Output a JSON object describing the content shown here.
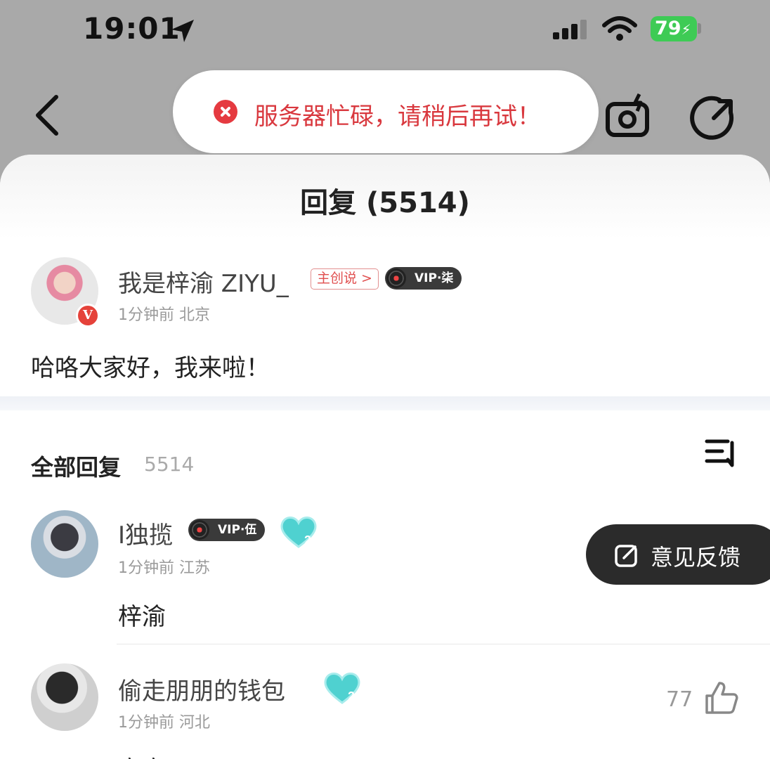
{
  "status_bar": {
    "time": "19:01",
    "battery": "79",
    "icons": [
      "location-arrow-icon",
      "signal-icon",
      "wifi-icon",
      "battery-charging-icon"
    ]
  },
  "nav": {
    "icons": [
      "back-icon",
      "camera-icon",
      "share-icon"
    ]
  },
  "toast": {
    "message": "服务器忙碌，请稍后再试！",
    "icon": "error-icon",
    "color": "#d9383e"
  },
  "sheet": {
    "title": "回复 (5514)"
  },
  "author": {
    "name": "我是梓渝 ZIYU_",
    "creator_tag": "主创说 >",
    "vip": "VIP·柒",
    "verified_badge": "V",
    "meta": "1分钟前 北京",
    "comment": "哈咯大家好，我来啦！"
  },
  "replies_section": {
    "title": "全部回复",
    "count": "5514",
    "sort_icon": "sort-icon"
  },
  "replies": [
    {
      "name": "I独揽",
      "vip": "VIP·伍",
      "heart_level": "2",
      "meta": "1分钟前 江苏",
      "text": "梓渝"
    },
    {
      "name": "偷走朋朋的钱包",
      "heart_level": "2",
      "meta": "1分钟前 河北",
      "likes": "77",
      "text": "宝宝"
    }
  ],
  "feedback_button": {
    "label": "意见反馈",
    "icon": "edit-icon"
  },
  "colors": {
    "accent_red": "#e5423a",
    "battery_green": "#3ecb55",
    "heart_teal": "#4fd1d0"
  }
}
